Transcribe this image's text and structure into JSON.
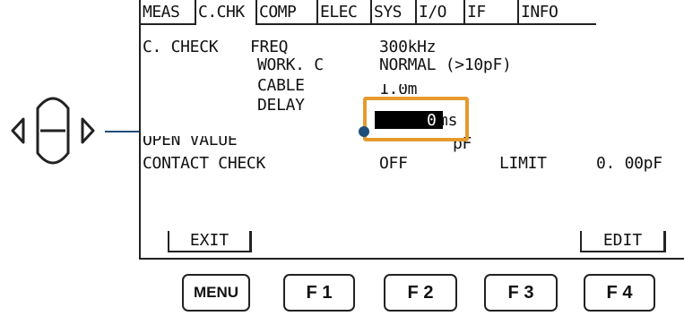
{
  "tabs": [
    {
      "label": "MEAS",
      "active": false
    },
    {
      "label": "C.CHK",
      "active": true
    },
    {
      "label": "COMP",
      "active": false
    },
    {
      "label": "ELEC",
      "active": false
    },
    {
      "label": "SYS",
      "active": false
    },
    {
      "label": "I/O",
      "active": false
    },
    {
      "label": "IF",
      "active": false
    },
    {
      "label": "INFO",
      "active": false
    }
  ],
  "settings": {
    "section_title": "C. CHECK",
    "freq_label": "FREQ",
    "freq_value": "300kHz",
    "workc_label": "WORK. C",
    "workc_value": "NORMAL (>10pF)",
    "cable_label": "CABLE",
    "cable_value_partial": "1.0m",
    "delay_label": "DELAY",
    "delay_value": "0ms",
    "open_label": "OPEN VALUE",
    "open_value_partial": "pF",
    "contact_label": "CONTACT CHECK",
    "contact_value": "OFF",
    "limit_label": "LIMIT",
    "limit_value": "0. 00pF"
  },
  "softkeys": {
    "exit": "EXIT",
    "edit": "EDIT"
  },
  "hardkeys": {
    "menu": "MENU",
    "f1": "F 1",
    "f2": "F 2",
    "f3": "F 3",
    "f4": "F 4"
  },
  "colors": {
    "highlight": "#e69a2e",
    "pointer": "#1f4e79"
  },
  "icons": {
    "knob": "rotary-knob-icon"
  }
}
